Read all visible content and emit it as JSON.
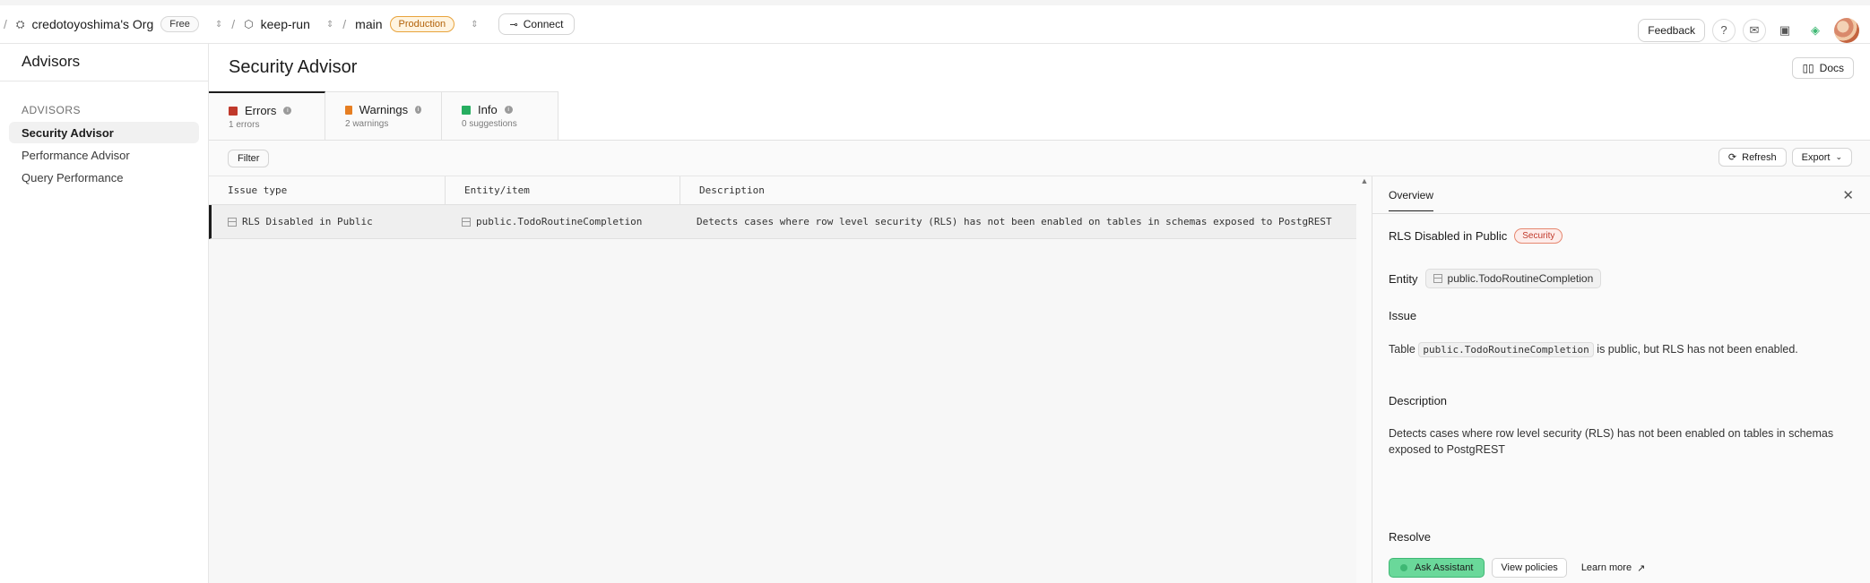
{
  "topbar": {
    "org": "credotoyoshima's Org",
    "plan": "Free",
    "project": "keep-run",
    "branch": "main",
    "env": "Production",
    "connect": "Connect",
    "feedback": "Feedback"
  },
  "sidebar": {
    "title": "Advisors",
    "section": "ADVISORS",
    "items": [
      {
        "label": "Security Advisor"
      },
      {
        "label": "Performance Advisor"
      },
      {
        "label": "Query Performance"
      }
    ]
  },
  "main": {
    "title": "Security Advisor",
    "docs": "Docs",
    "tabs": [
      {
        "label": "Errors",
        "sub": "1 errors",
        "color": "#c0392b"
      },
      {
        "label": "Warnings",
        "sub": "2 warnings",
        "color": "#e67e22"
      },
      {
        "label": "Info",
        "sub": "0 suggestions",
        "color": "#27ae60"
      }
    ],
    "filter": "Filter",
    "refresh": "Refresh",
    "export": "Export"
  },
  "grid": {
    "headers": [
      "Issue type",
      "Entity/item",
      "Description"
    ],
    "rows": [
      {
        "issue": "RLS Disabled in Public",
        "entity": "public.TodoRoutineCompletion",
        "description": "Detects cases where row level security (RLS) has not been enabled on tables in schemas exposed to PostgREST"
      }
    ]
  },
  "panel": {
    "tab": "Overview",
    "title": "RLS Disabled in Public",
    "badge": "Security",
    "entity_label": "Entity",
    "entity": "public.TodoRoutineCompletion",
    "issue_heading": "Issue",
    "issue_prefix": "Table",
    "issue_code": "public.TodoRoutineCompletion",
    "issue_suffix": "is public, but RLS has not been enabled.",
    "description_heading": "Description",
    "description_line1": "Detects cases where row level security (RLS) has not been enabled on tables in schemas",
    "description_line2": "exposed to PostgREST",
    "resolve_heading": "Resolve",
    "ask": "Ask Assistant",
    "view_policies": "View policies",
    "learn_more": "Learn more"
  }
}
